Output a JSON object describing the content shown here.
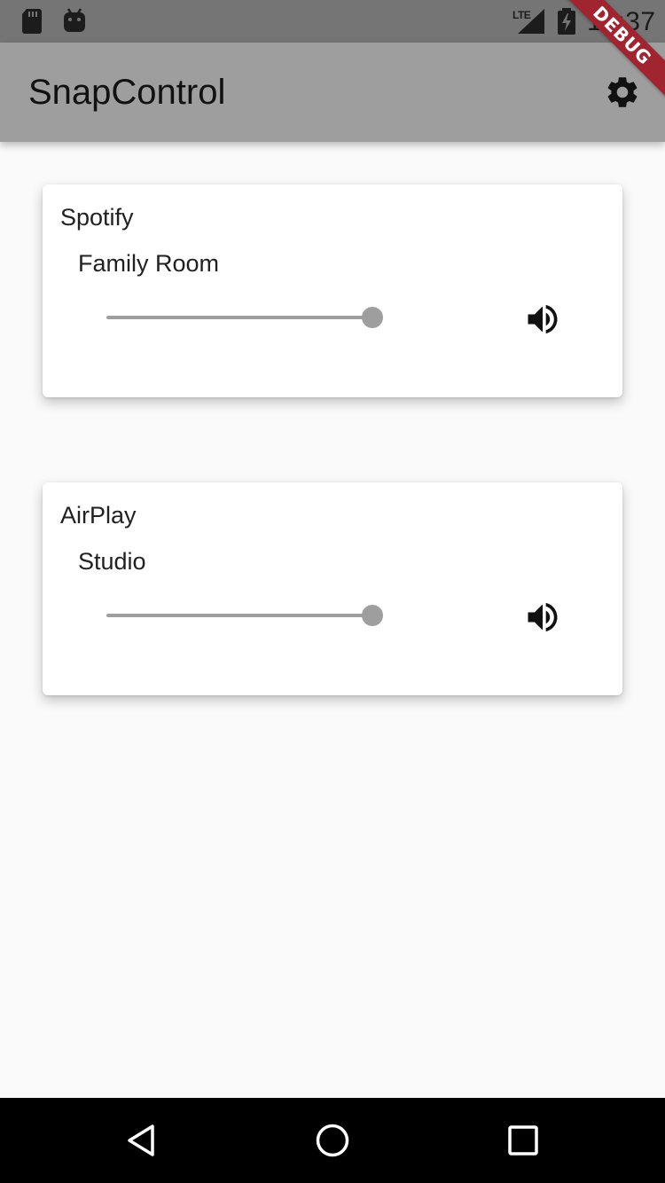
{
  "status_bar": {
    "network_label": "LTE",
    "time": "12:37",
    "icons": [
      "sd-card-icon",
      "android-icon",
      "signal-icon",
      "battery-charging-icon"
    ]
  },
  "debug_banner": "DEBUG",
  "app_bar": {
    "title": "SnapControl",
    "action_icon": "settings-icon"
  },
  "groups": [
    {
      "stream": "Spotify",
      "client": "Family Room",
      "volume": 1.0,
      "icon": "volume-up-icon"
    },
    {
      "stream": "AirPlay",
      "client": "Studio",
      "volume": 1.0,
      "icon": "volume-up-icon"
    }
  ],
  "nav_bar": {
    "buttons": [
      "back-icon",
      "home-icon",
      "recents-icon"
    ]
  },
  "colors": {
    "app_bar": "#9e9e9e",
    "status_bar": "#757575",
    "accent": "#9e9e9e",
    "debug": "#a02530"
  }
}
